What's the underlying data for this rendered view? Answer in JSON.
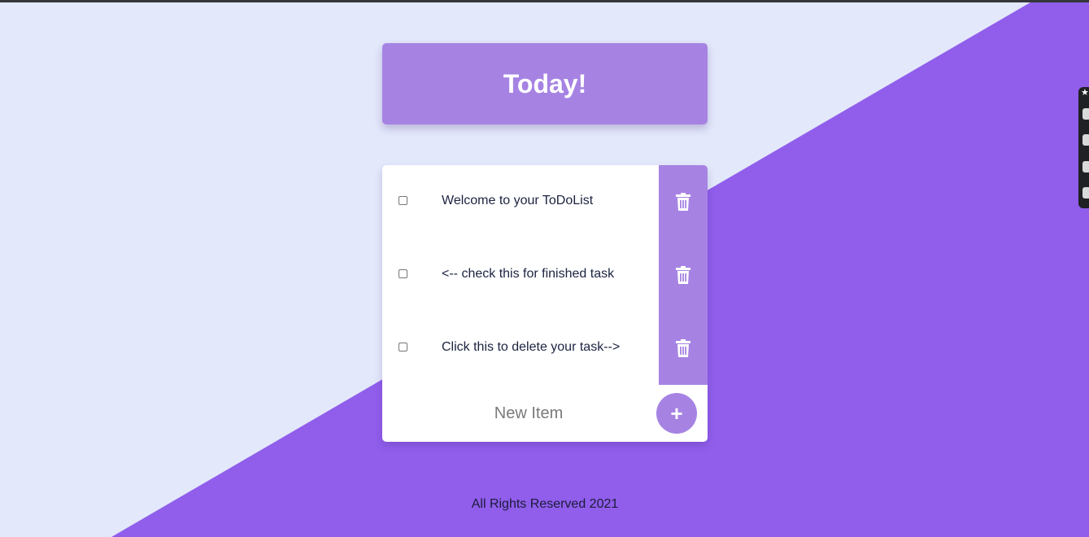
{
  "colors": {
    "background_light": "#e3e8fb",
    "background_purple": "#905eeb",
    "accent": "#a683e3",
    "text_dark": "#1b2340"
  },
  "header": {
    "title": "Today!"
  },
  "items": [
    {
      "label": "Welcome to your ToDoList",
      "checked": false
    },
    {
      "label": "<-- check this for finished task",
      "checked": false
    },
    {
      "label": "Click this to delete your task-->",
      "checked": false
    }
  ],
  "new_item": {
    "placeholder": "New Item",
    "add_label": "+"
  },
  "footer": {
    "text": "All Rights Reserved 2021"
  },
  "icons": {
    "delete": "trash-icon",
    "add": "plus-icon",
    "side_toolbar": [
      "pin-icon",
      "camera-icon",
      "square-icon",
      "copy-icon",
      "puzzle-icon"
    ]
  }
}
